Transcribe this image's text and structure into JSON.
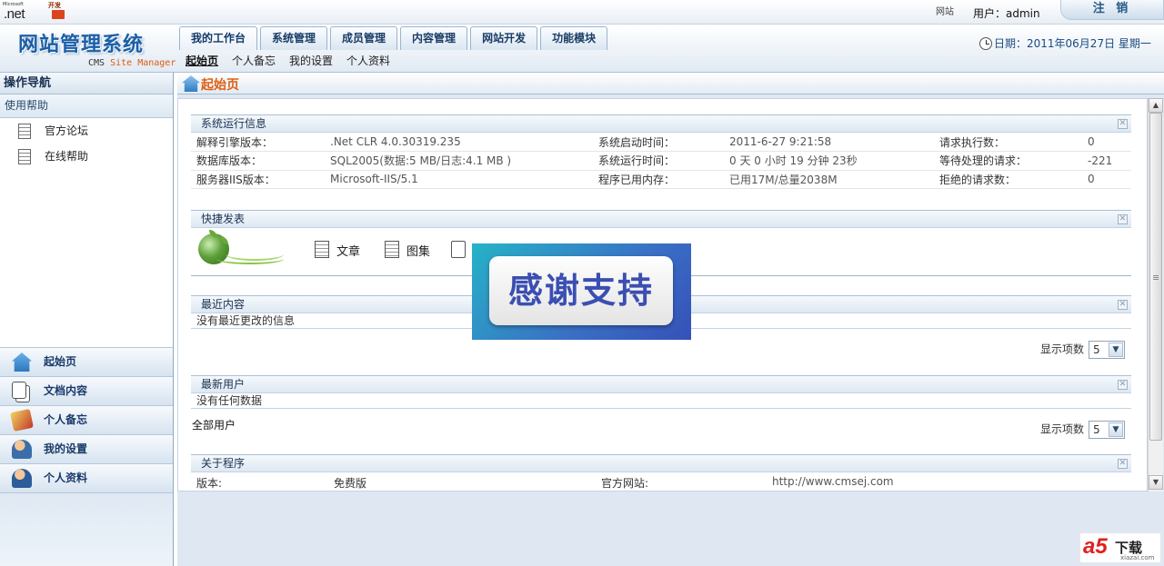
{
  "topbar": {
    "ms_small": "Microsoft",
    "net_logo": ".net",
    "dev_logo": "开发",
    "site_label": "网站",
    "user_text": "用户：admin",
    "logout_label": "注 销"
  },
  "header": {
    "brand": "网站管理系统",
    "brand_sub_cms": "CMS",
    "brand_sub_site": "Site Manager",
    "date_text": "日期：2011年06月27日 星期一",
    "tabs": [
      {
        "label": "我的工作台"
      },
      {
        "label": "系统管理"
      },
      {
        "label": "成员管理"
      },
      {
        "label": "内容管理"
      },
      {
        "label": "网站开发"
      },
      {
        "label": "功能模块"
      }
    ],
    "subnav": [
      {
        "label": "起始页"
      },
      {
        "label": "个人备忘"
      },
      {
        "label": "我的设置"
      },
      {
        "label": "个人资料"
      }
    ]
  },
  "sidebar": {
    "title": "操作导航",
    "category": "使用帮助",
    "links": [
      {
        "label": "官方论坛"
      },
      {
        "label": "在线帮助"
      }
    ],
    "modules": [
      {
        "label": "起始页",
        "icon": "home-icon"
      },
      {
        "label": "文档内容",
        "icon": "documents-icon"
      },
      {
        "label": "个人备忘",
        "icon": "memo-icon"
      },
      {
        "label": "我的设置",
        "icon": "user-settings-icon"
      },
      {
        "label": "个人资料",
        "icon": "user-profile-icon"
      }
    ]
  },
  "main": {
    "title": "起始页",
    "sysinfo": {
      "title": "系统运行信息",
      "rows": [
        [
          "解释引擎版本：",
          ".Net CLR 4.0.30319.235",
          "系统启动时间：",
          "2011-6-27 9:21:58",
          "请求执行数：",
          "0"
        ],
        [
          "数据库版本：",
          "SQL2005(数据:5 MB/日志:4.1 MB )",
          "系统运行时间：",
          "0 天  0 小时  19 分钟  23秒",
          "等待处理的请求：",
          "-221"
        ],
        [
          "服务器IIS版本：",
          "Microsoft-IIS/5.1",
          "程序已用内存：",
          "已用17M/总量2038M",
          "拒绝的请求数：",
          "0"
        ]
      ]
    },
    "quick": {
      "title": "快捷发表",
      "items": [
        {
          "label": "文章"
        },
        {
          "label": "图集"
        }
      ]
    },
    "recent": {
      "title": "最近内容",
      "empty_text": "没有最近更改的信息",
      "count_label": "显示项数",
      "count_value": "5"
    },
    "users": {
      "title": "最新用户",
      "empty_text": "没有任何数据",
      "all_users": "全部用户",
      "count_label": "显示项数",
      "count_value": "5"
    },
    "about": {
      "title": "关于程序",
      "version_label": "版本:",
      "version_value": "免费版",
      "site_label": "官方网站:",
      "site_value": "http://www.cmsej.com"
    }
  },
  "overlay": {
    "text": "感谢支持"
  },
  "watermark": {
    "brand": "a5",
    "download": "下载",
    "url": "xiazai.com"
  }
}
